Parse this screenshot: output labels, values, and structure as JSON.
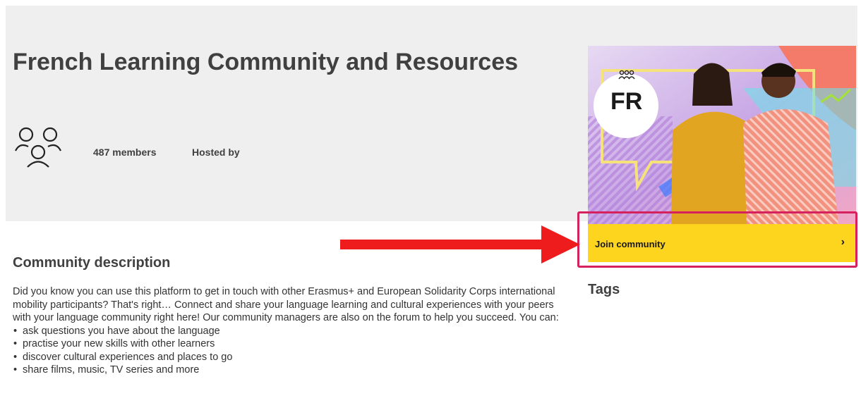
{
  "header": {
    "title": "French Learning Community and Resources",
    "members": "487 members",
    "hosted_by": "Hosted by"
  },
  "card": {
    "badge_text": "FR",
    "join_label": "Join community",
    "join_chevron": "›",
    "accent_color": "#fdd51f",
    "highlight_color": "#d6215f"
  },
  "tags": {
    "title": "Tags"
  },
  "description": {
    "title": "Community description",
    "intro": "Did you know you can use this platform to get in touch with other Erasmus+ and European Solidarity Corps  international mobility participants? That's right… Connect and share your language learning and cultural experiences with your peers with your language community right here! Our community managers are also on the forum to help you succeed. You can:",
    "items": [
      "ask questions you have about the language",
      "practise your new skills with other learners",
      "discover cultural experiences and places to go",
      "share films, music, TV series and more"
    ]
  },
  "icons": {
    "members": "people-group-icon",
    "badge": "people-icon",
    "arrow": "red-arrow-icon"
  }
}
